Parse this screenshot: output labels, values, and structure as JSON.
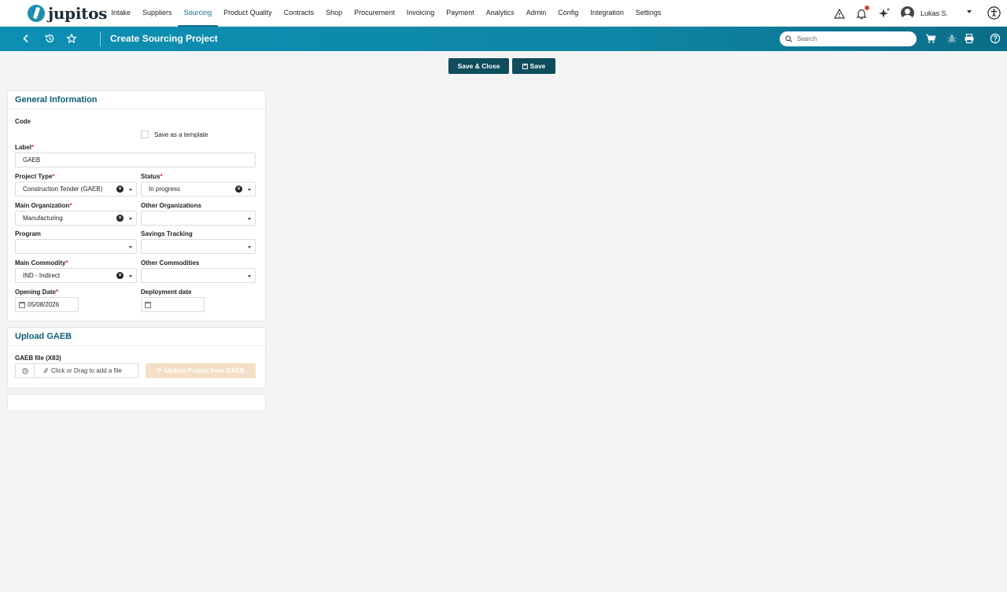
{
  "brand": {
    "name": "jupitos"
  },
  "nav": {
    "items": [
      "Intake",
      "Suppliers",
      "Sourcing",
      "Product Quality",
      "Contracts",
      "Shop",
      "Procurement",
      "Invoicing",
      "Payment",
      "Analytics",
      "Admin",
      "Config",
      "Integration",
      "Settings"
    ],
    "active": "Sourcing",
    "user_name": "Lukas S."
  },
  "header": {
    "title": "Create Sourcing Project",
    "search_placeholder": "Search"
  },
  "actions": {
    "save_close": "Save & Close",
    "save": "Save"
  },
  "general": {
    "title": "General Information",
    "code_label": "Code",
    "template_label": "Save as a template",
    "template_checked": false,
    "label_label": "Label",
    "label_value": "GAEB",
    "project_type_label": "Project Type",
    "project_type_value": "Construction Tender (GAEB)",
    "status_label": "Status",
    "status_value": "In progress",
    "main_org_label": "Main Organization",
    "main_org_value": "Manufacturing",
    "other_orgs_label": "Other Organizations",
    "other_orgs_value": "",
    "program_label": "Program",
    "program_value": "",
    "savings_label": "Savings Tracking",
    "savings_value": "",
    "main_commodity_label": "Main Commodity",
    "main_commodity_value": "IND - Indirect",
    "other_commodities_label": "Other Commodities",
    "other_commodities_value": "",
    "opening_date_label": "Opening Date",
    "opening_date_value": "05/08/2026",
    "deployment_date_label": "Deployment date",
    "deployment_date_value": ""
  },
  "upload": {
    "title": "Upload GAEB",
    "file_label": "GAEB file (X83)",
    "dropzone_text": "Click or Drag to add a file",
    "update_button": "Update Project from GAEB"
  },
  "colors": {
    "primary": "#0f6f8a",
    "header": "#0e87a7",
    "dark_button": "#0f4d5c",
    "disabled_button": "#f3dfc6",
    "required": "#d9342b",
    "notification": "#e0443c"
  }
}
